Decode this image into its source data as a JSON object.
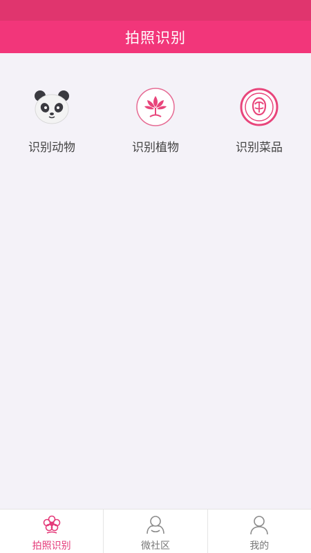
{
  "header": {
    "title": "拍照识别"
  },
  "features": [
    {
      "label": "识别动物",
      "icon": "panda-icon"
    },
    {
      "label": "识别植物",
      "icon": "plant-icon"
    },
    {
      "label": "识别菜品",
      "icon": "dish-icon"
    }
  ],
  "tabs": [
    {
      "label": "拍照识别",
      "icon": "flower-icon",
      "active": true
    },
    {
      "label": "微社区",
      "icon": "community-icon",
      "active": false
    },
    {
      "label": "我的",
      "icon": "user-icon",
      "active": false
    }
  ],
  "colors": {
    "status_bar": "#e0356e",
    "header": "#f2367a",
    "accent": "#e43a79",
    "background": "#f4f2f8",
    "tab_inactive": "#777777"
  }
}
